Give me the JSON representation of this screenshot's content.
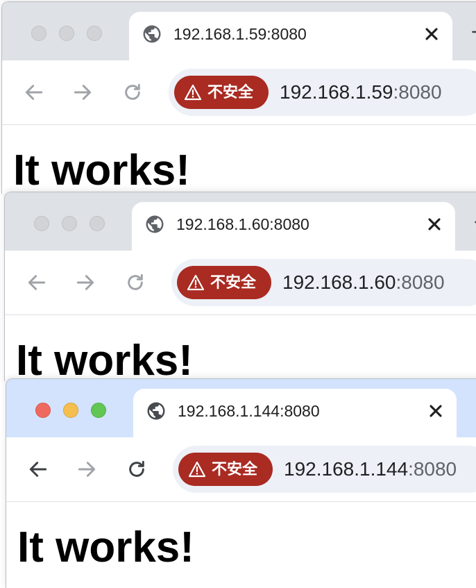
{
  "windows": [
    {
      "state": "inactive",
      "tab_title": "192.168.1.59:8080",
      "security_badge": "不安全",
      "url_host": "192.168.1.59",
      "url_port": ":8080",
      "page_heading": "It works!"
    },
    {
      "state": "inactive",
      "tab_title": "192.168.1.60:8080",
      "security_badge": "不安全",
      "url_host": "192.168.1.60",
      "url_port": ":8080",
      "page_heading": "It works!"
    },
    {
      "state": "active",
      "tab_title": "192.168.1.144:8080",
      "security_badge": "不安全",
      "url_host": "192.168.1.144",
      "url_port": ":8080",
      "page_heading": "It works!"
    }
  ],
  "icons": {
    "tab": "globe-icon",
    "close": "close-icon",
    "new_tab": "plus-icon",
    "back": "arrow-left-icon",
    "forward": "arrow-right-icon",
    "reload": "reload-icon",
    "warning": "warning-triangle-icon"
  },
  "colors": {
    "security_badge_bg": "#a92b22",
    "active_tabstrip": "#d3e3fd",
    "inactive_tabstrip": "#dee1e6",
    "omnibox_bg": "#edf0f6",
    "traffic_close": "#ee6a5f",
    "traffic_minimize": "#f5bf4f",
    "traffic_zoom": "#62c655"
  }
}
